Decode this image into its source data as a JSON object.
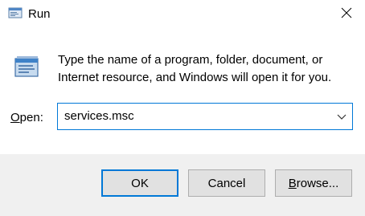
{
  "window": {
    "title": "Run",
    "icon": "run-icon",
    "close_icon": "close-icon"
  },
  "content": {
    "icon": "run-program-icon",
    "description_line1": "Type the name of a program, folder, document, or",
    "description_line2": "Internet resource, and Windows will open it for you.",
    "open_label_accel": "O",
    "open_label_rest": "pen:",
    "open_value": "services.msc",
    "dropdown_icon": "chevron-down-icon"
  },
  "buttons": {
    "ok": "OK",
    "cancel": "Cancel",
    "browse_accel": "B",
    "browse_rest": "rowse..."
  },
  "colors": {
    "accent": "#0078d7",
    "footer_bg": "#f0f0f0",
    "button_bg": "#e1e1e1",
    "button_border": "#adadad"
  }
}
